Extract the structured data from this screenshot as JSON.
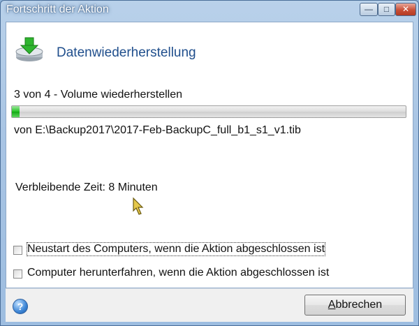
{
  "window": {
    "title": "Fortschritt der Aktion",
    "controls": {
      "minimize": "—",
      "maximize": "□",
      "close": "✕"
    }
  },
  "header": {
    "title": "Datenwiederherstellung",
    "icon": "restore-disk-icon"
  },
  "progress": {
    "step_text": "3 von 4 - Volume wiederherstellen",
    "fraction": 0.02,
    "source_text": "von E:\\Backup2017\\2017-Feb-BackupC_full_b1_s1_v1.tib"
  },
  "remaining_time": "Verbleibende Zeit: 8 Minuten",
  "options": [
    {
      "label": "Neustart des Computers, wenn die Aktion abgeschlossen ist",
      "checked": false
    },
    {
      "label": "Computer herunterfahren, wenn die Aktion abgeschlossen ist",
      "checked": false
    }
  ],
  "footer": {
    "help_icon": "help-icon",
    "help_glyph": "?",
    "cancel_prefix": "",
    "cancel_mnemonic": "A",
    "cancel_rest": "bbrechen"
  },
  "colors": {
    "accent": "#1f4e8c",
    "progress": "#22c322"
  }
}
